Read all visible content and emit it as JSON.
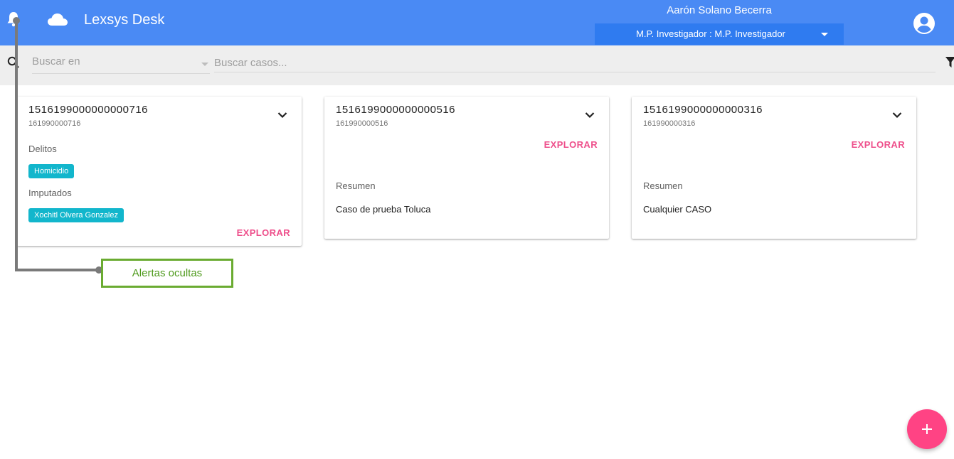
{
  "header": {
    "app_title": "Lexsys Desk",
    "user_name": "Aarón Solano Becerra",
    "role": "M.P. Investigador : M.P. Investigador",
    "bell_icon": "bell-icon",
    "cloud_icon": "cloud-icon",
    "account_icon": "account-circle-icon",
    "color": "#4a8af4"
  },
  "search": {
    "scope_placeholder": "Buscar en",
    "placeholder": "Buscar casos...",
    "search_icon": "search-icon",
    "filter_icon": "filter-icon"
  },
  "cards": [
    {
      "number": "1516199000000000716",
      "sub": "161990000716",
      "delitos_label": "Delitos",
      "delito": "Homicidio",
      "imputados_label": "Imputados",
      "imputado": "Xochitl Olvera Gonzalez",
      "explore": "EXPLORAR"
    },
    {
      "number": "1516199000000000516",
      "sub": "161990000516",
      "explore": "EXPLORAR",
      "summary_label": "Resumen",
      "summary": "Caso de prueba Toluca"
    },
    {
      "number": "1516199000000000316",
      "sub": "161990000316",
      "explore": "EXPLORAR",
      "summary_label": "Resumen",
      "summary": "Cualquier CASO"
    }
  ],
  "annotation": {
    "text": "Alertas ocultas"
  },
  "colors": {
    "accent": "#ee4f8b",
    "chip": "#12b6cc",
    "annotation": "#6aab31",
    "fab": "#ff4384"
  }
}
